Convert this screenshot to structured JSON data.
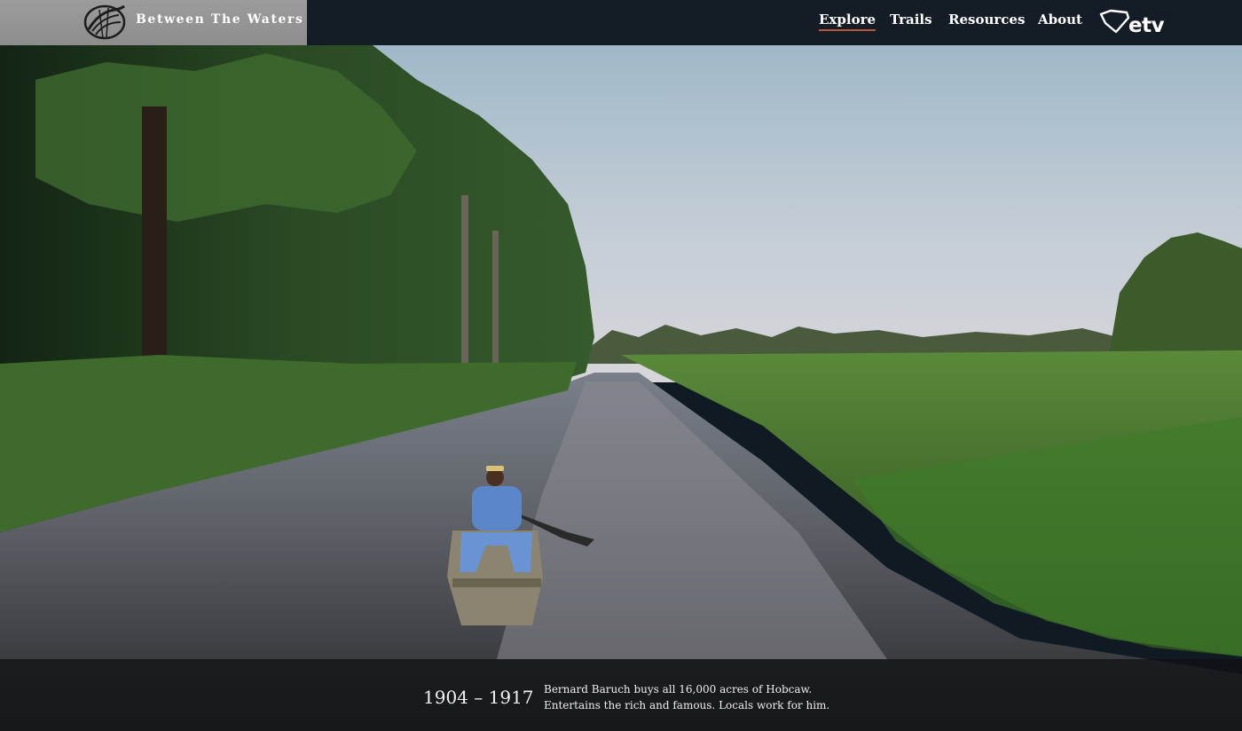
{
  "header": {
    "brand_title": "Between The Waters",
    "logo_icon": "heron-bird-logo-icon",
    "nav": [
      {
        "label": "Explore",
        "active": true
      },
      {
        "label": "Trails",
        "active": false
      },
      {
        "label": "Resources",
        "active": false
      },
      {
        "label": "About",
        "active": false
      }
    ],
    "etv_logo": {
      "icon": "south-carolina-outline-icon",
      "label": "etv"
    }
  },
  "caption": {
    "years": "1904 – 1917",
    "text": "Bernard Baruch buys all 16,000 acres of Hobcaw. Entertains the rich and famous. Locals work for him."
  },
  "colors": {
    "header_bg": "#141c25",
    "brand_bg": "#939393",
    "nav_active_underline": "#b7553a",
    "caption_bg": "rgba(16,18,20,0.74)"
  }
}
